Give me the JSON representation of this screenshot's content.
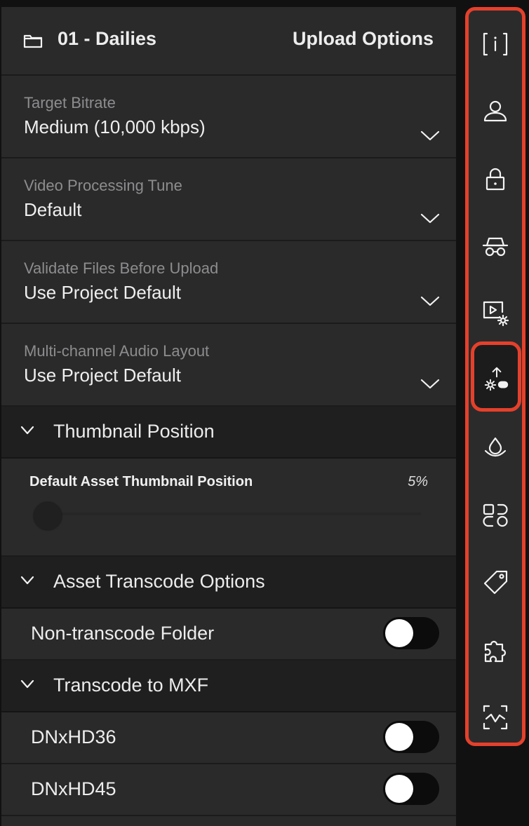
{
  "header": {
    "folder_name": "01 - Dailies",
    "right_title": "Upload Options"
  },
  "selects": [
    {
      "label": "Target Bitrate",
      "value": "Medium (10,000 kbps)"
    },
    {
      "label": "Video Processing Tune",
      "value": "Default"
    },
    {
      "label": "Validate Files Before Upload",
      "value": "Use Project Default"
    },
    {
      "label": "Multi-channel Audio Layout",
      "value": "Use Project Default"
    }
  ],
  "sections": {
    "thumbnail": {
      "title": "Thumbnail Position",
      "slider_label": "Default Asset Thumbnail Position",
      "slider_value": "5%",
      "slider_fraction": 0.05
    },
    "transcode": {
      "title": "Asset Transcode Options",
      "toggle_label": "Non-transcode Folder",
      "toggle_on": false
    },
    "mxf": {
      "title": "Transcode to MXF",
      "items": [
        {
          "label": "DNxHD36",
          "on": false
        },
        {
          "label": "DNxHD45",
          "on": false
        }
      ]
    }
  },
  "rail": {
    "accent": "#e5402b",
    "items": [
      "info-icon",
      "user-icon",
      "lock-icon",
      "incognito-icon",
      "video-settings-icon",
      "upload-settings-icon",
      "droplet-icon",
      "shapes-icon",
      "tag-icon",
      "puzzle-icon",
      "activity-icon"
    ],
    "active": "upload-settings-icon"
  }
}
